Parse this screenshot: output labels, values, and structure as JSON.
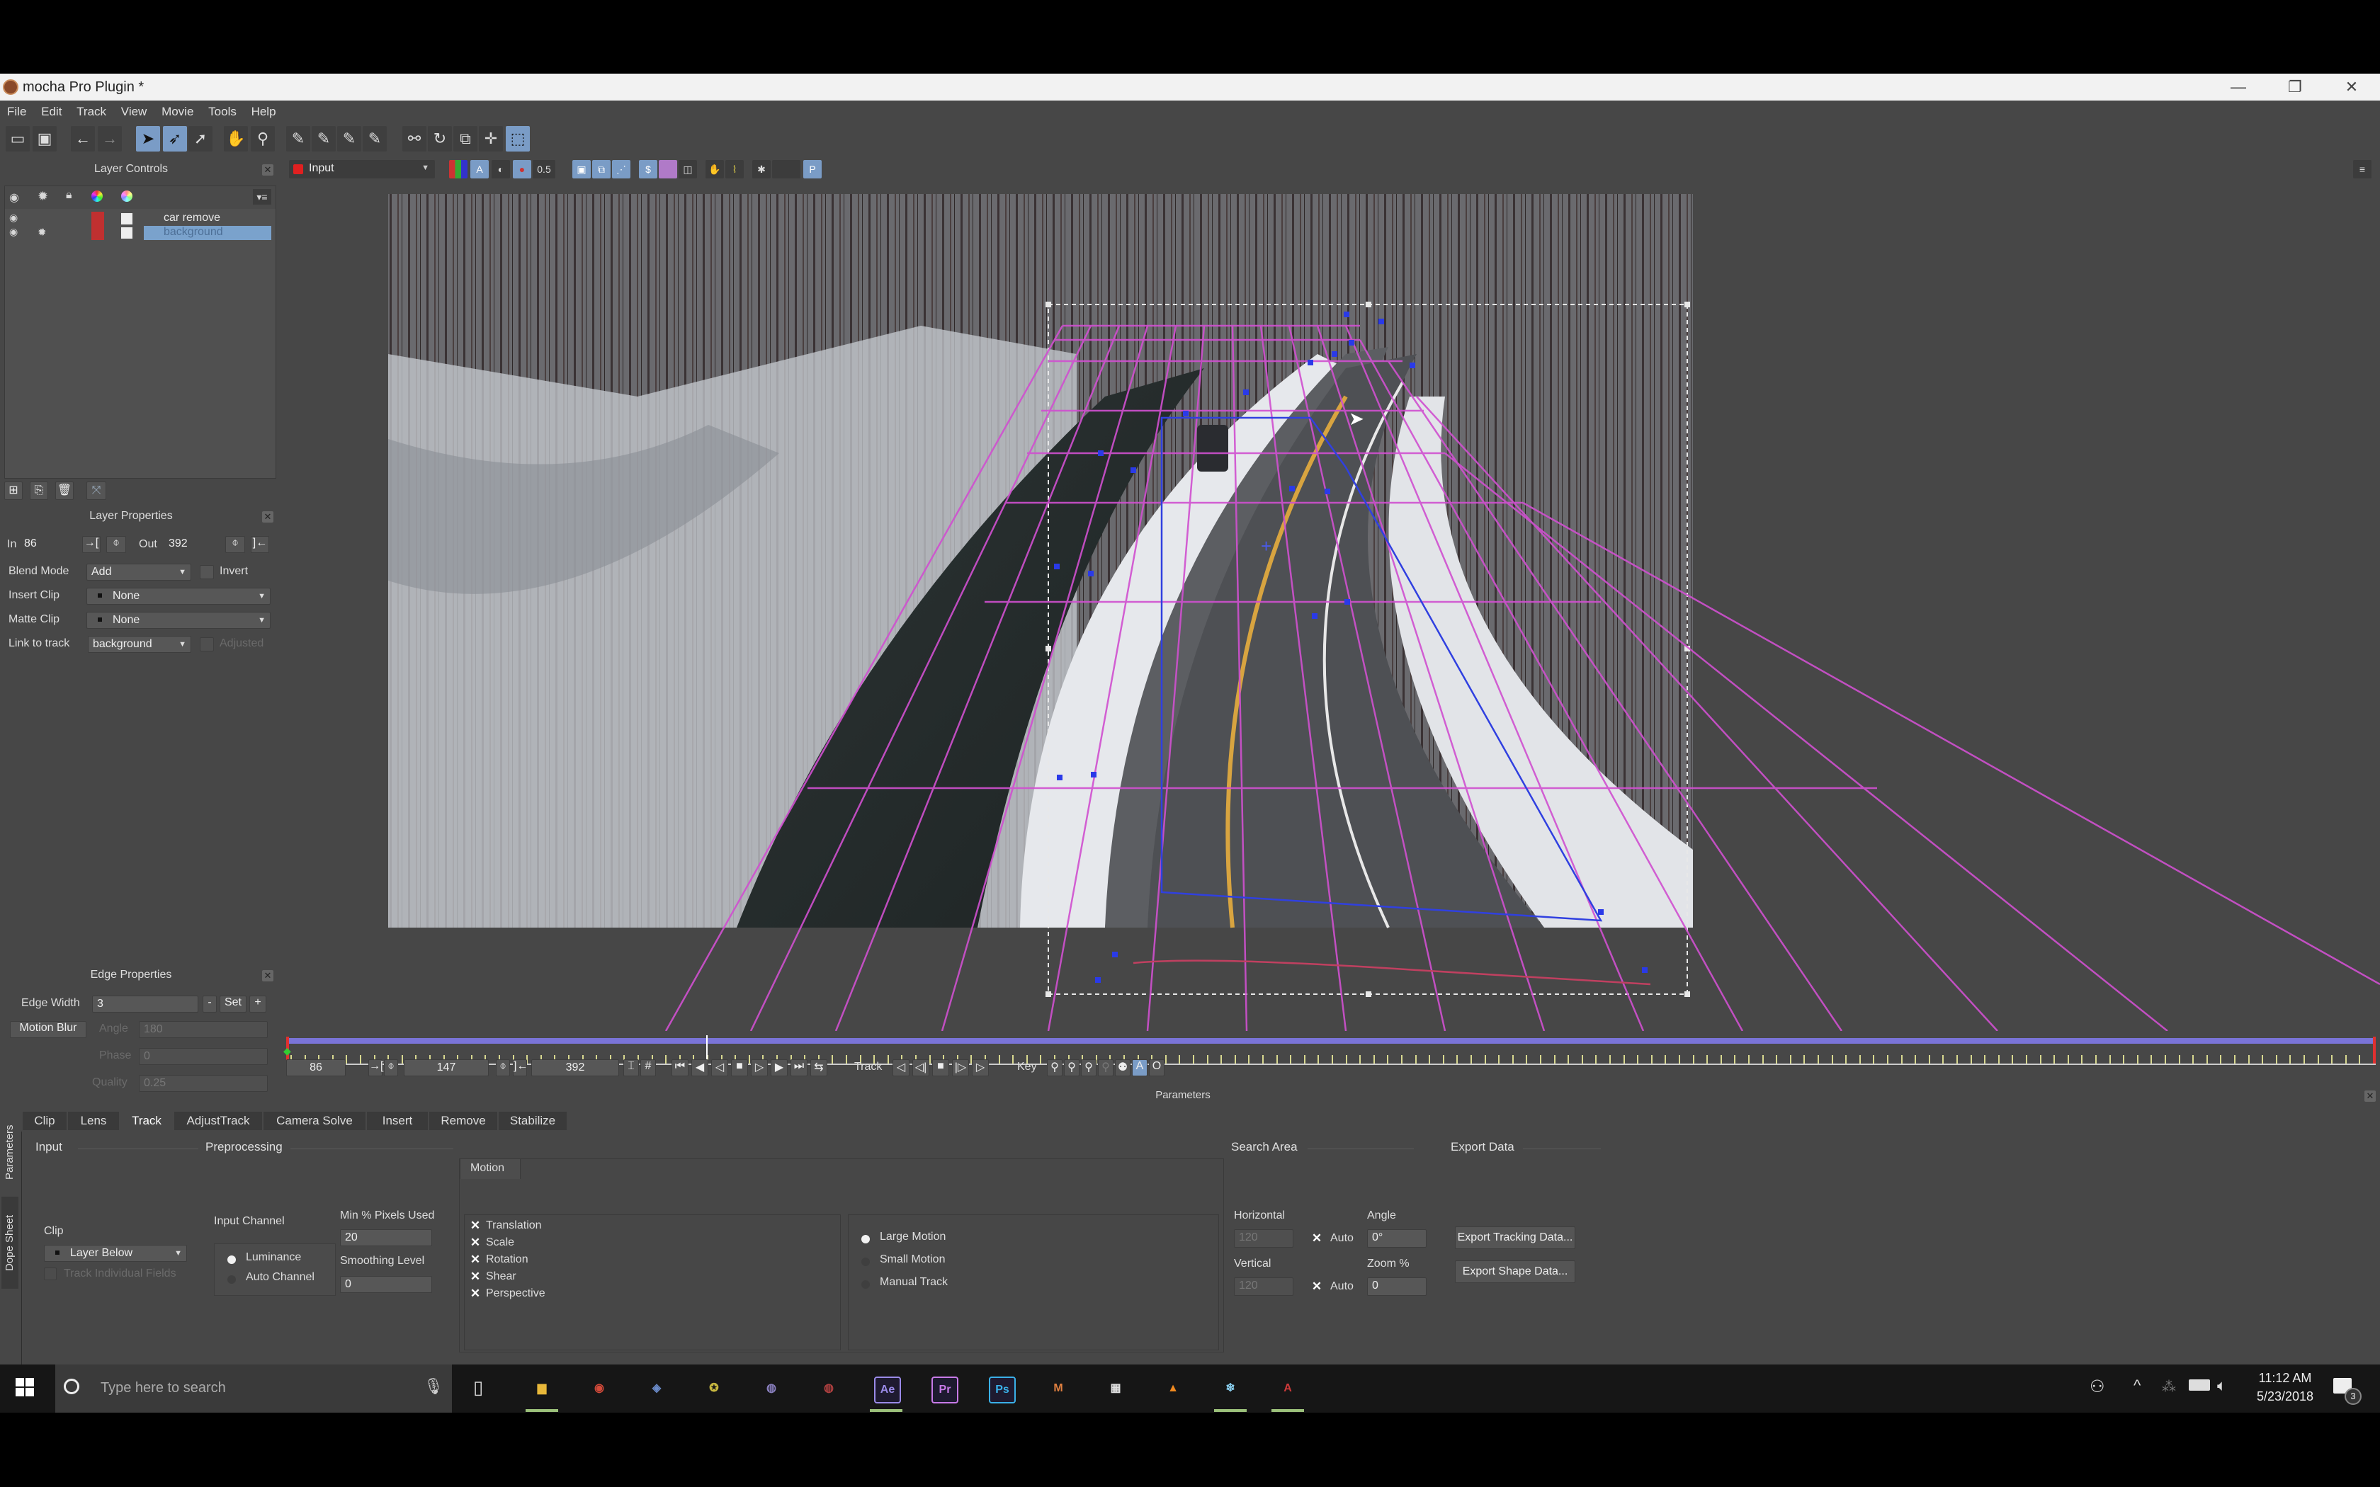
{
  "window": {
    "title": "mocha Pro Plugin *",
    "controls": {
      "minimize": "—",
      "maximize": "❐",
      "close": "✕"
    }
  },
  "menu": [
    "File",
    "Edit",
    "Track",
    "View",
    "Movie",
    "Tools",
    "Help"
  ],
  "toolbar": {
    "icons": [
      "open-icon",
      "save-icon",
      "undo-arrow-icon",
      "redo-arrow-icon",
      "select-pointer-icon",
      "select-bezier-icon",
      "add-point-icon",
      "pan-hand-icon",
      "zoom-magnifier-icon",
      "xspline-pen-icon",
      "xspline-add-icon",
      "bezier-pen-icon",
      "bezier-add-icon",
      "link-icon",
      "rotate-icon",
      "scale-icon",
      "move-icon",
      "surface-select-icon"
    ]
  },
  "viewer_bar": {
    "clip_dropdown": "Input",
    "opacity_value": "0.5",
    "proxy_label": "P"
  },
  "layer_controls": {
    "title": "Layer Controls",
    "layers": [
      {
        "name": "car remove",
        "selected": false,
        "color": "#d03a3a"
      },
      {
        "name": "background",
        "selected": true,
        "color": "#d03a3a"
      }
    ]
  },
  "layer_properties": {
    "title": "Layer Properties",
    "in_label": "In",
    "in_value": "86",
    "out_label": "Out",
    "out_value": "392",
    "blend_mode_label": "Blend Mode",
    "blend_mode_value": "Add",
    "invert_label": "Invert",
    "insert_clip_label": "Insert Clip",
    "insert_clip_value": "None",
    "matte_clip_label": "Matte Clip",
    "matte_clip_value": "None",
    "link_to_track_label": "Link to track",
    "link_to_track_value": "background",
    "adjusted_label": "Adjusted"
  },
  "edge_properties": {
    "title": "Edge Properties",
    "edge_width_label": "Edge Width",
    "edge_width_value": "3",
    "minus": "-",
    "set": "Set",
    "plus": "+",
    "motion_blur_label": "Motion Blur",
    "angle_label": "Angle",
    "angle_value": "180",
    "phase_label": "Phase",
    "phase_value": "0",
    "quality_label": "Quality",
    "quality_value": "0.25"
  },
  "timeline": {
    "in_frame": "86",
    "current_frame": "147",
    "out_frame": "392",
    "playhead_fraction": 0.2,
    "track_label": "Track",
    "key_label": "Key",
    "auto_key": "A",
    "keyframe_o": "O"
  },
  "parameters": {
    "header": "Parameters",
    "side_tabs": [
      "Parameters",
      "Dope Sheet"
    ],
    "tabs": [
      "Clip",
      "Lens",
      "Track",
      "AdjustTrack",
      "Camera Solve",
      "Insert",
      "Remove",
      "Stabilize"
    ],
    "active_tab": "Track",
    "input": {
      "section": "Input",
      "clip_label": "Clip",
      "clip_value": "Layer Below",
      "track_fields_label": "Track Individual Fields"
    },
    "preprocessing": {
      "section": "Preprocessing",
      "input_channel_label": "Input Channel",
      "channels": [
        {
          "label": "Luminance",
          "selected": true
        },
        {
          "label": "Auto Channel",
          "selected": false
        }
      ],
      "min_pixels_label": "Min % Pixels Used",
      "min_pixels_value": "20",
      "smoothing_label": "Smoothing Level",
      "smoothing_value": "0"
    },
    "motion": {
      "tab": "Motion",
      "checks": [
        "Translation",
        "Scale",
        "Rotation",
        "Shear",
        "Perspective"
      ],
      "modes": [
        {
          "label": "Large Motion",
          "selected": true
        },
        {
          "label": "Small Motion",
          "selected": false
        },
        {
          "label": "Manual Track",
          "selected": false
        }
      ]
    },
    "search_area": {
      "section": "Search Area",
      "horizontal_label": "Horizontal",
      "horizontal_value": "120",
      "vertical_label": "Vertical",
      "vertical_value": "120",
      "auto_label": "Auto",
      "angle_label": "Angle",
      "angle_value": "0°",
      "zoom_label": "Zoom %",
      "zoom_value": "0"
    },
    "export": {
      "section": "Export Data",
      "tracking_button": "Export Tracking Data...",
      "shape_button": "Export Shape Data..."
    }
  },
  "taskbar": {
    "search_placeholder": "Type here to search",
    "apps": [
      {
        "name": "file-explorer",
        "glyph": "▆",
        "color": "#e8b83a",
        "running": true
      },
      {
        "name": "chrome",
        "glyph": "◉",
        "color": "#d44a3a",
        "running": false
      },
      {
        "name": "davinci-resolve",
        "glyph": "◈",
        "color": "#6a8ac8",
        "running": false
      },
      {
        "name": "app-yellow",
        "glyph": "✪",
        "color": "#c8b840",
        "running": false
      },
      {
        "name": "app-purple-disc",
        "glyph": "◍",
        "color": "#8a80c0",
        "running": false
      },
      {
        "name": "app-red-disc",
        "glyph": "◍",
        "color": "#b04040",
        "running": false
      },
      {
        "name": "after-effects",
        "glyph": "Ae",
        "color": "#9a8ae8",
        "running": true
      },
      {
        "name": "premiere",
        "glyph": "Pr",
        "color": "#c87ae8",
        "running": false
      },
      {
        "name": "photoshop",
        "glyph": "Ps",
        "color": "#3ab0e8",
        "running": false
      },
      {
        "name": "mocha",
        "glyph": "M",
        "color": "#e08040",
        "running": false
      },
      {
        "name": "calculator",
        "glyph": "▦",
        "color": "#e0e0e0",
        "running": false
      },
      {
        "name": "vlc",
        "glyph": "▲",
        "color": "#f08a20",
        "running": false
      },
      {
        "name": "app-snowflake",
        "glyph": "❄",
        "color": "#8ad0f0",
        "running": true
      },
      {
        "name": "acrobat",
        "glyph": "A",
        "color": "#d03a3a",
        "running": true
      }
    ],
    "time": "11:12 AM",
    "date": "5/23/2018",
    "notifications": "3"
  }
}
